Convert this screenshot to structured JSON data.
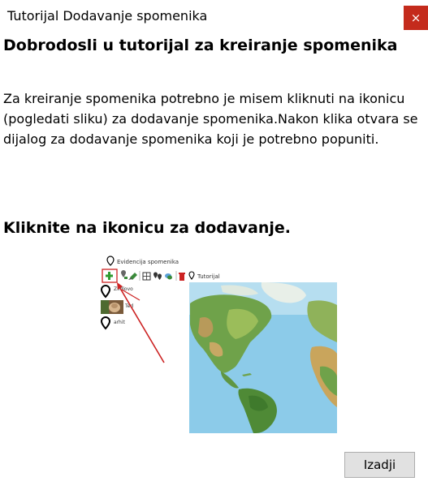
{
  "window": {
    "title": "Tutorijal Dodavanje spomenika",
    "close_glyph": "×"
  },
  "content": {
    "heading": "Dobrodosli u tutorijal za kreiranje spomenika",
    "paragraph": "Za kreiranje spomenika potrebno je misem kliknuti na ikonicu (pogledati sliku) za dodavanje spomenika.Nakon klika otvara se dijalog za dodavanje spomenika koji je potrebno popuniti.",
    "instruction": "Kliknite na ikonicu za dodavanje."
  },
  "screenshot": {
    "window_title": "Evidencija spomenika",
    "toolbar_label": "Tutorijal",
    "list_items": [
      "Zildlovo",
      "Ted",
      "arhit"
    ]
  },
  "footer": {
    "exit_label": "Izadji"
  },
  "colors": {
    "close_bg": "#c42b1c",
    "arrow": "#cc2222",
    "ocean": "#7fc7e8",
    "land": "#6fa24a"
  }
}
